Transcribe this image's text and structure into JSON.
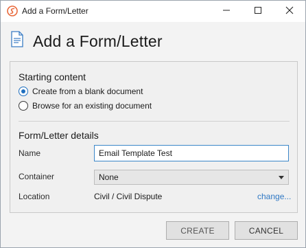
{
  "window": {
    "title": "Add a Form/Letter"
  },
  "header": {
    "title": "Add a Form/Letter"
  },
  "starting_content": {
    "title": "Starting content",
    "options": [
      {
        "label": "Create from a blank document",
        "checked": true
      },
      {
        "label": "Browse for an existing document",
        "checked": false
      }
    ]
  },
  "details": {
    "title": "Form/Letter details",
    "name_label": "Name",
    "name_value": "Email Template Test",
    "container_label": "Container",
    "container_value": "None",
    "location_label": "Location",
    "location_value": "Civil / Civil Dispute",
    "change_link": "change..."
  },
  "buttons": {
    "create": "CREATE",
    "cancel": "CANCEL"
  },
  "colors": {
    "accent": "#1f6fbf",
    "link": "#2f78c4",
    "app_icon": "#e8683a"
  },
  "icons": {
    "app": "app-logo-icon",
    "doc": "document-icon",
    "minimize": "minimize-icon",
    "maximize": "maximize-icon",
    "close": "close-icon",
    "dropdown": "chevron-down-icon"
  }
}
